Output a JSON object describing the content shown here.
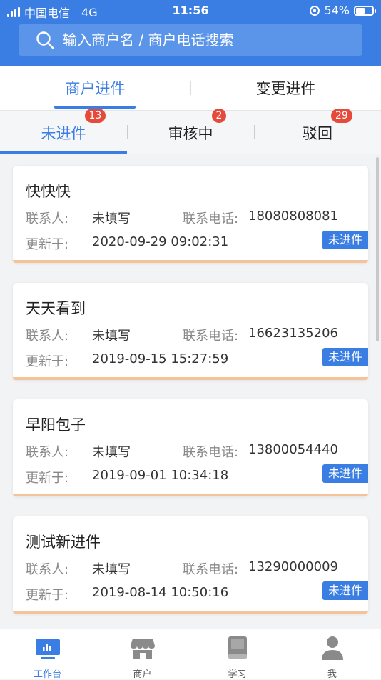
{
  "status_bar": {
    "carrier": "中国电信",
    "network": "4G",
    "time": "11:56",
    "battery": "54%",
    "battery_level": 0.54
  },
  "search": {
    "placeholder": "输入商户名 / 商户电话搜索"
  },
  "primary_tabs": [
    {
      "label": "商户进件",
      "active": true
    },
    {
      "label": "变更进件",
      "active": false
    }
  ],
  "secondary_tabs": [
    {
      "label": "未进件",
      "badge": "13",
      "active": true
    },
    {
      "label": "审核中",
      "badge": "2",
      "active": false
    },
    {
      "label": "驳回",
      "badge": "29",
      "active": false
    }
  ],
  "labels": {
    "contact": "联系人:",
    "phone": "联系电话:",
    "updated": "更新于:"
  },
  "cards": [
    {
      "name": "快快快",
      "contact": "未填写",
      "phone": "18080808081",
      "updated": "2020-09-29 09:02:31",
      "status": "未进件"
    },
    {
      "name": "天天看到",
      "contact": "未填写",
      "phone": "16623135206",
      "updated": "2019-09-15 15:27:59",
      "status": "未进件"
    },
    {
      "name": "早阳包子",
      "contact": "未填写",
      "phone": "13800054440",
      "updated": "2019-09-01 10:34:18",
      "status": "未进件"
    },
    {
      "name": "测试新进件",
      "contact": "未填写",
      "phone": "13290000009",
      "updated": "2019-08-14 10:50:16",
      "status": "未进件"
    }
  ],
  "bottom_nav": [
    {
      "label": "工作台",
      "icon": "dashboard-icon",
      "active": true
    },
    {
      "label": "商户",
      "icon": "store-icon",
      "active": false
    },
    {
      "label": "学习",
      "icon": "book-icon",
      "active": false
    },
    {
      "label": "我",
      "icon": "user-icon",
      "active": false
    }
  ],
  "colors": {
    "primary": "#3a7de3",
    "badge": "#e64a3b",
    "card_bar": "#f4c39a"
  }
}
